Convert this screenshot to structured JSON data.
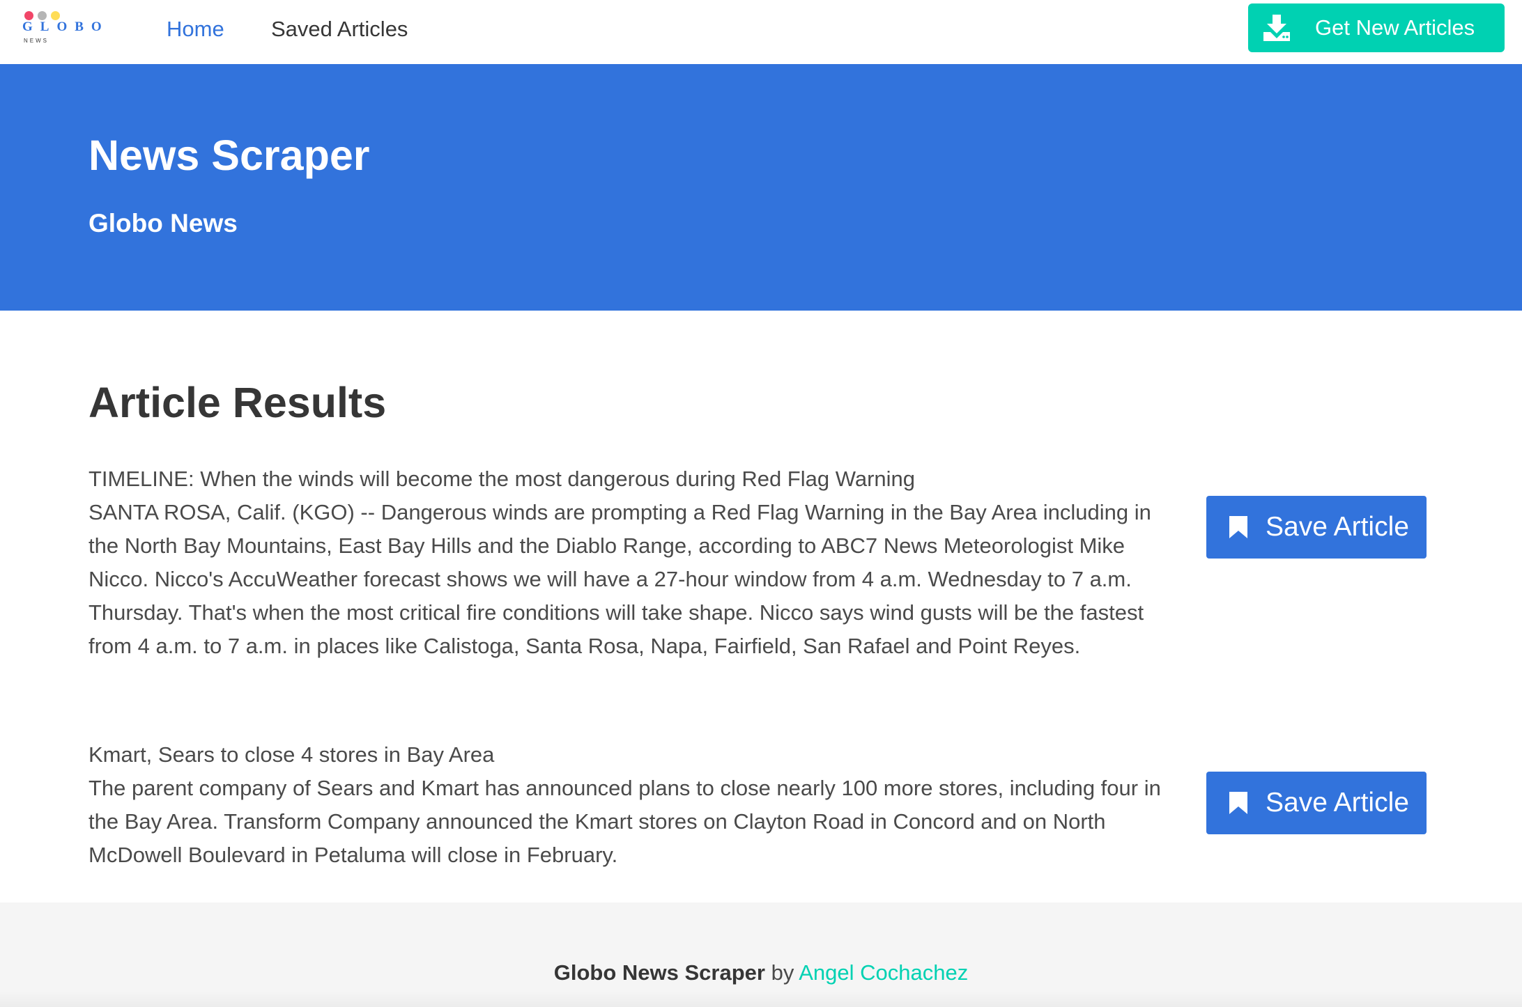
{
  "navbar": {
    "logo": {
      "wordmark": "GLOBO",
      "sub": "NEWS",
      "dot_colors": [
        "#f14668",
        "#b5b5b5",
        "#ffdd57"
      ]
    },
    "links": {
      "home": "Home",
      "saved": "Saved Articles"
    },
    "get_button_label": "Get New Articles",
    "get_button_icon": "download-icon"
  },
  "hero": {
    "title": "News Scraper",
    "subtitle": "Globo News"
  },
  "main": {
    "title": "Article Results",
    "articles": [
      {
        "headline": "TIMELINE: When the winds will become the most dangerous during Red Flag Warning",
        "summary": "SANTA ROSA, Calif. (KGO) -- Dangerous winds are prompting a Red Flag Warning in the Bay Area including in the North Bay Mountains, East Bay Hills and the Diablo Range, according to ABC7 News Meteorologist Mike Nicco. Nicco's AccuWeather forecast shows we will have a 27-hour window from 4 a.m. Wednesday to 7 a.m. Thursday. That's when the most critical fire conditions will take shape. Nicco says wind gusts will be the fastest from 4 a.m. to 7 a.m. in places like Calistoga, Santa Rosa, Napa, Fairfield, San Rafael and Point Reyes.",
        "save_label": "Save Article"
      },
      {
        "headline": "Kmart, Sears to close 4 stores in Bay Area",
        "summary": "The parent company of Sears and Kmart has announced plans to close nearly 100 more stores, including four in the Bay Area. Transform Company announced the Kmart stores on Clayton Road in Concord and on North McDowell Boulevard in Petaluma will close in February.",
        "save_label": "Save Article"
      }
    ],
    "save_icon": "bookmark-icon"
  },
  "footer": {
    "brand": "Globo News Scraper",
    "by": "by",
    "author": "Angel Cochachez"
  },
  "colors": {
    "primary": "#3273dc",
    "accent": "#00d1b2",
    "footer_bg": "#f5f5f5",
    "text": "#363636"
  }
}
